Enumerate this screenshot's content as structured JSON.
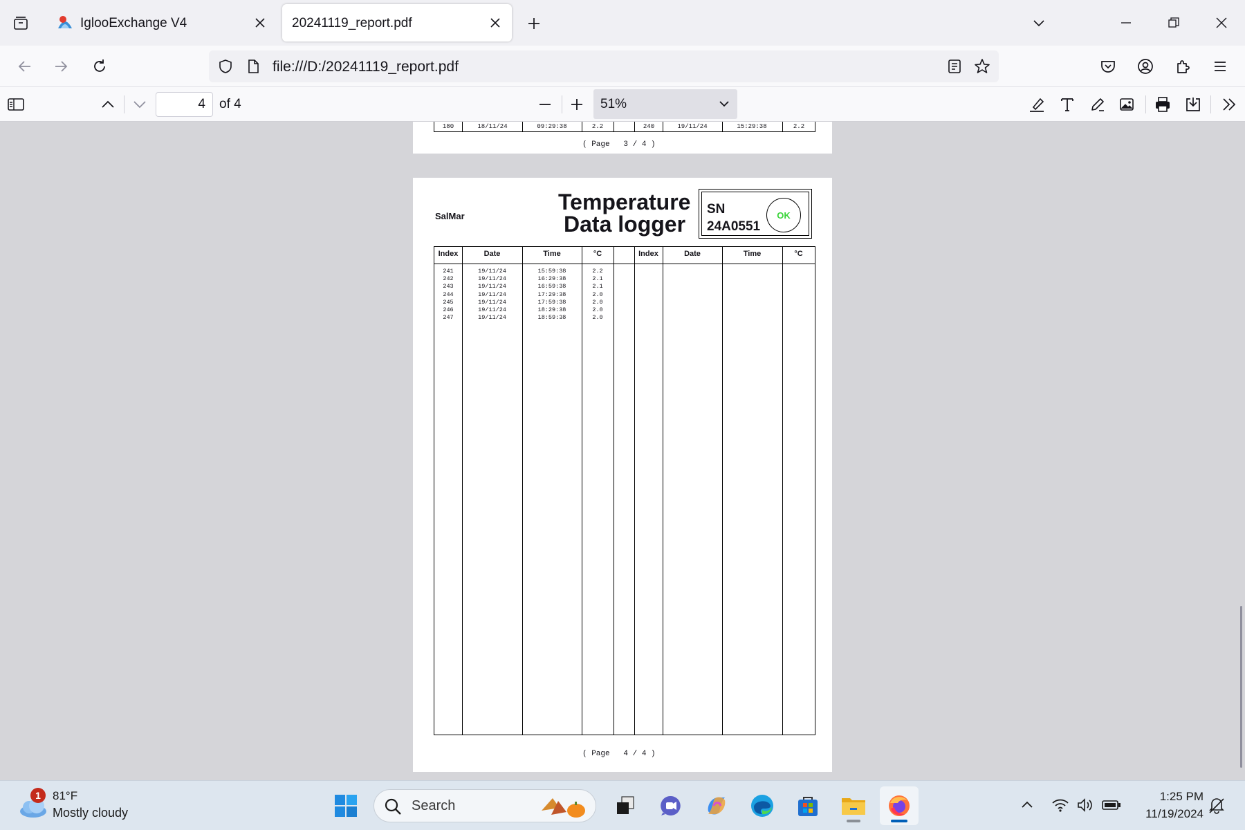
{
  "browser": {
    "tabs": [
      {
        "title": "IglooExchange V4",
        "active": false
      },
      {
        "title": "20241119_report.pdf",
        "active": true
      }
    ],
    "url": "file:///D:/20241119_report.pdf"
  },
  "pdf_toolbar": {
    "current_page": "4",
    "page_count_label": "of 4",
    "zoom": "51%"
  },
  "prev_page": {
    "last_row_left": {
      "index": "180",
      "date": "18/11/24",
      "time": "09:29:38",
      "temp": "2.2"
    },
    "last_row_right": {
      "index": "240",
      "date": "19/11/24",
      "time": "15:29:38",
      "temp": "2.2"
    },
    "footer": "( Page   3 / 4 )"
  },
  "page": {
    "company": "SalMar",
    "title_line1": "Temperature",
    "title_line2": "Data logger",
    "sn_label": "SN",
    "sn_value": "24A0551",
    "status": "OK",
    "status_color": "#3ad53a",
    "headers": {
      "index": "Index",
      "date": "Date",
      "time": "Time",
      "temp": "°C"
    },
    "rows": [
      {
        "index": "241",
        "date": "19/11/24",
        "time": "15:59:38",
        "temp": "2.2"
      },
      {
        "index": "242",
        "date": "19/11/24",
        "time": "16:29:38",
        "temp": "2.1"
      },
      {
        "index": "243",
        "date": "19/11/24",
        "time": "16:59:38",
        "temp": "2.1"
      },
      {
        "index": "244",
        "date": "19/11/24",
        "time": "17:29:38",
        "temp": "2.0"
      },
      {
        "index": "245",
        "date": "19/11/24",
        "time": "17:59:38",
        "temp": "2.0"
      },
      {
        "index": "246",
        "date": "19/11/24",
        "time": "18:29:38",
        "temp": "2.0"
      },
      {
        "index": "247",
        "date": "19/11/24",
        "time": "18:59:38",
        "temp": "2.0"
      }
    ],
    "footer": "( Page   4 / 4 )"
  },
  "taskbar": {
    "weather_temp": "81°F",
    "weather_desc": "Mostly cloudy",
    "notification_count": "1",
    "search_label": "Search",
    "time": "1:25 PM",
    "date": "11/19/2024"
  },
  "colors": {
    "accent": "#005fb8",
    "firefox_orange": "#ff7139"
  },
  "icons": [
    "tabs-list-icon",
    "igloo-favicon",
    "close-icon",
    "plus-icon",
    "chevron-down-icon",
    "minimize-icon",
    "restore-icon",
    "back-icon",
    "forward-icon",
    "reload-icon",
    "shield-icon",
    "file-icon",
    "reader-view-icon",
    "star-icon",
    "pocket-icon",
    "account-icon",
    "extensions-icon",
    "menu-icon",
    "sidebar-toggle-icon",
    "chevron-up-icon",
    "minus-icon",
    "highlight-icon",
    "text-icon",
    "draw-icon",
    "image-icon",
    "print-icon",
    "save-icon",
    "double-chevron-right-icon",
    "cloud-icon",
    "windows-start-icon",
    "search-icon",
    "task-view-icon",
    "chat-icon",
    "copilot-icon",
    "edge-icon",
    "store-icon",
    "file-explorer-icon",
    "firefox-icon",
    "wifi-icon",
    "volume-icon",
    "battery-icon",
    "notification-icon"
  ]
}
